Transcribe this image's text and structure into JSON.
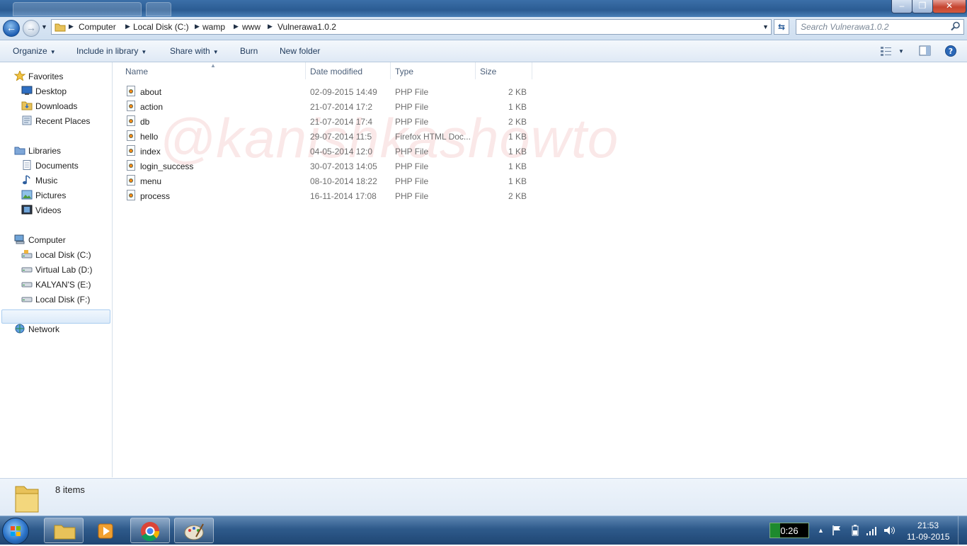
{
  "window": {
    "controls": {
      "minimize": "–",
      "maximize": "❐",
      "close": "✕"
    }
  },
  "address": {
    "crumbs": [
      "Computer",
      "Local Disk (C:)",
      "wamp",
      "www",
      "Vulnerawa1.0.2"
    ],
    "search_placeholder": "Search Vulnerawa1.0.2"
  },
  "toolbar": {
    "organize": "Organize",
    "include_in_library": "Include in library",
    "share_with": "Share with",
    "burn": "Burn",
    "new_folder": "New folder"
  },
  "nav": {
    "favorites": "Favorites",
    "desktop": "Desktop",
    "downloads": "Downloads",
    "recent_places": "Recent Places",
    "libraries": "Libraries",
    "documents": "Documents",
    "music": "Music",
    "pictures": "Pictures",
    "videos": "Videos",
    "computer": "Computer",
    "local_c": "Local Disk (C:)",
    "virtual_lab": "Virtual Lab (D:)",
    "kalyan": "KALYAN'S (E:)",
    "local_f": "Local Disk (F:)",
    "network": "Network"
  },
  "columns": {
    "name": "Name",
    "date": "Date modified",
    "type": "Type",
    "size": "Size"
  },
  "files": [
    {
      "name": "about",
      "date": "02-09-2015 14:49",
      "type": "PHP File",
      "size": "2 KB"
    },
    {
      "name": "action",
      "date": "21-07-2014 17:2",
      "type": "PHP File",
      "size": "1 KB"
    },
    {
      "name": "db",
      "date": "21-07-2014 17:4",
      "type": "PHP File",
      "size": "2 KB"
    },
    {
      "name": "hello",
      "date": "29-07-2014 11:5",
      "type": "Firefox HTML Doc...",
      "size": "1 KB"
    },
    {
      "name": "index",
      "date": "04-05-2014 12:0",
      "type": "PHP File",
      "size": "1 KB"
    },
    {
      "name": "login_success",
      "date": "30-07-2013 14:05",
      "type": "PHP File",
      "size": "1 KB"
    },
    {
      "name": "menu",
      "date": "08-10-2014 18:22",
      "type": "PHP File",
      "size": "1 KB"
    },
    {
      "name": "process",
      "date": "16-11-2014 17:08",
      "type": "PHP File",
      "size": "2 KB"
    }
  ],
  "watermark": "@kanishkashowto",
  "details": {
    "count": "8 items"
  },
  "taskbar": {
    "timer": "0:26",
    "time": "21:53",
    "date": "11-09-2015"
  }
}
